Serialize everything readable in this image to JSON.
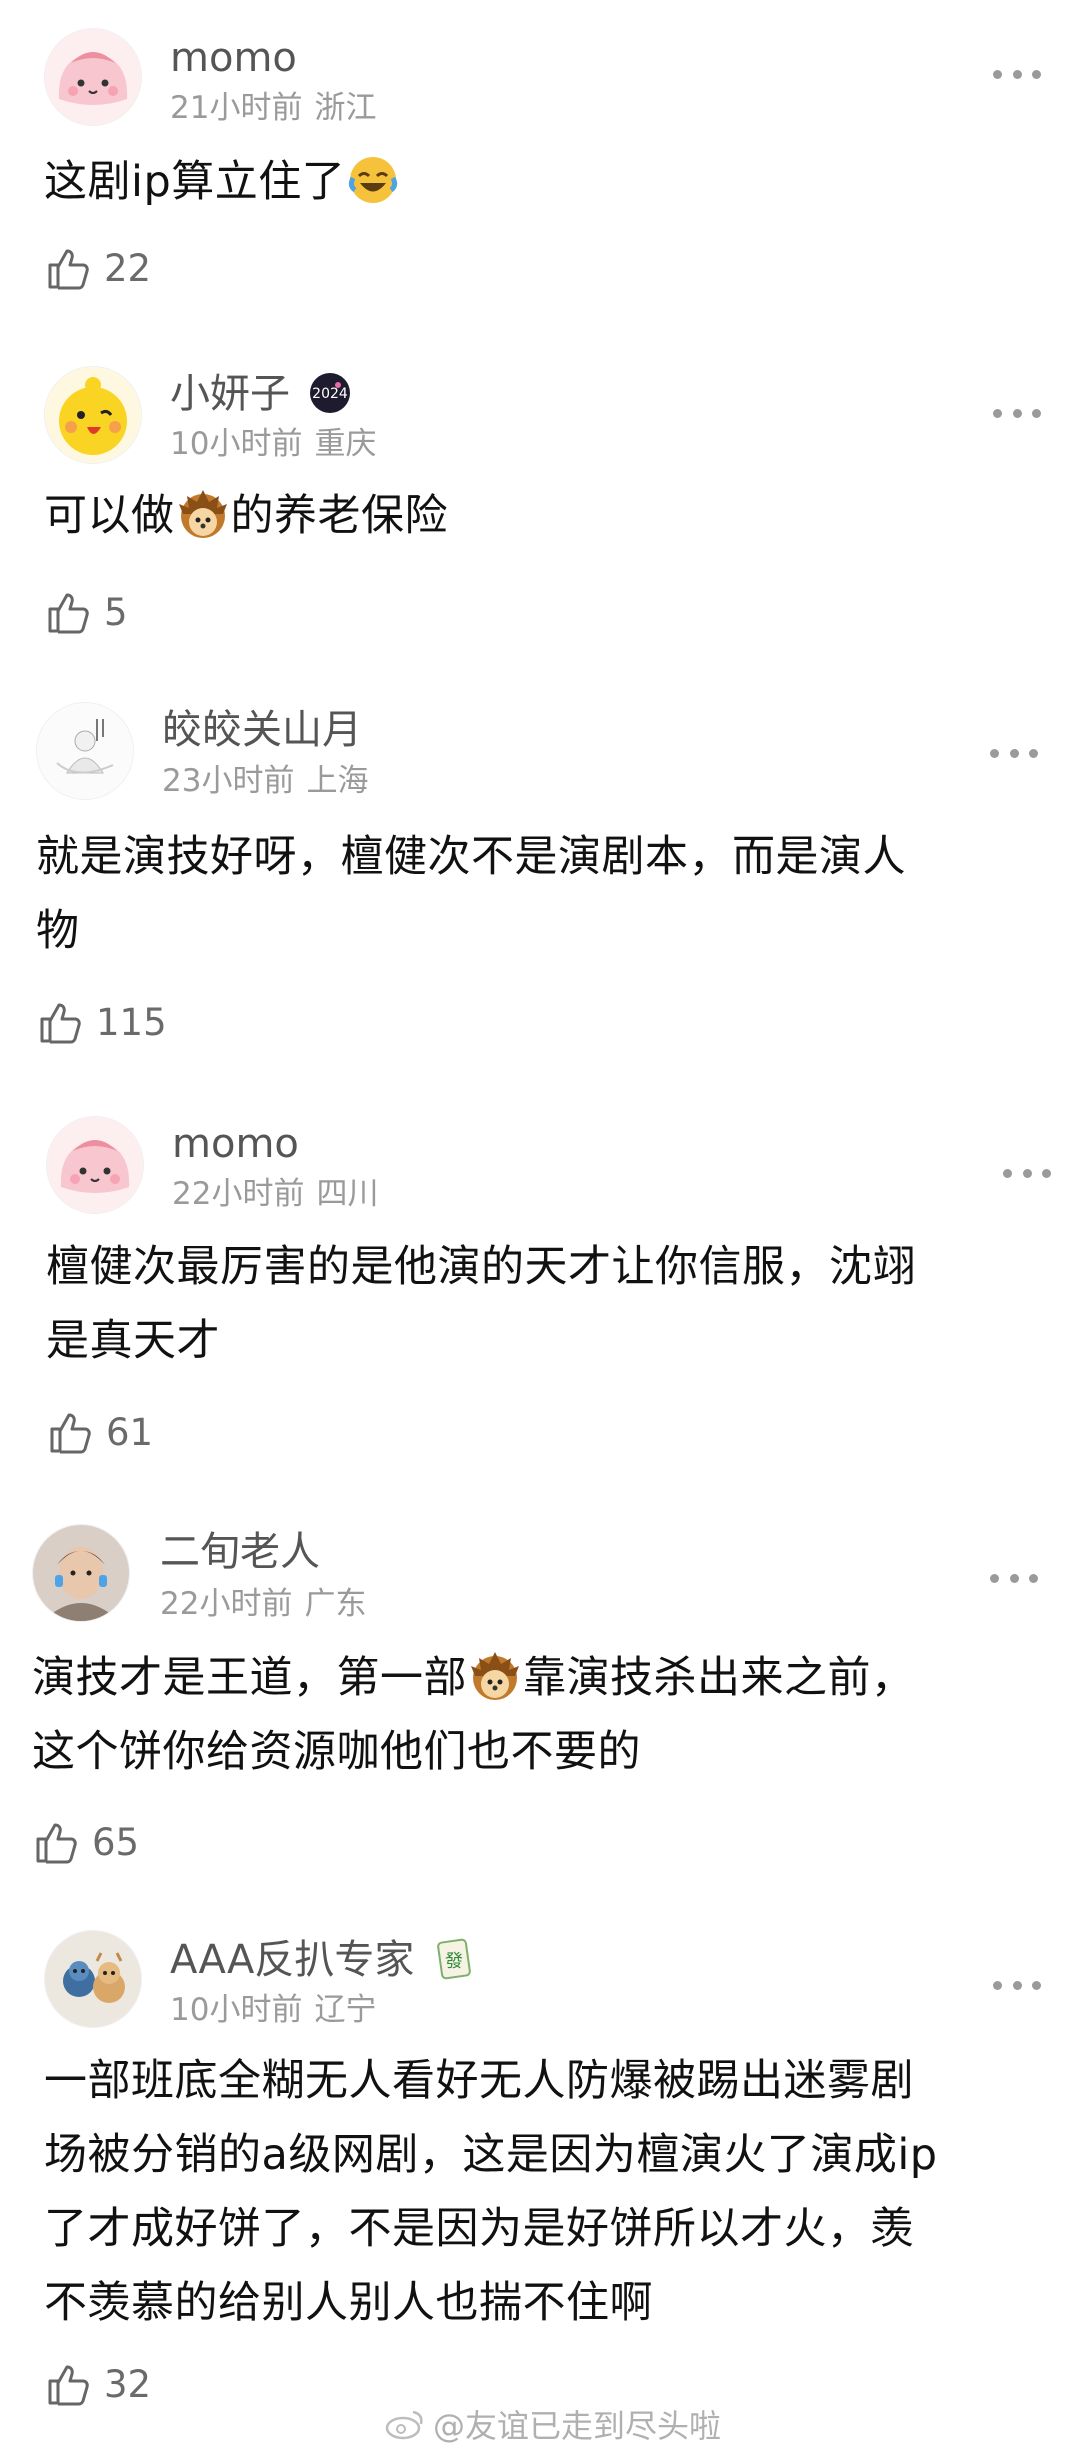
{
  "comments": [
    {
      "name": "momo",
      "time": "21小时前",
      "location": "浙江",
      "text_a": "这剧ip算立住了",
      "text_b": "",
      "text_c": "",
      "likes": "22",
      "avatar": "pink-blob-avatar",
      "emoji": "laugh-cry-emoji"
    },
    {
      "name": "小妍子",
      "time": "10小时前",
      "location": "重庆",
      "text_a": "可以做",
      "text_b": "的养老保险",
      "text_c": "",
      "likes": "5",
      "avatar": "yellow-chick-avatar",
      "emoji": "hedgehog-emoji"
    },
    {
      "name": "皎皎关山月",
      "time": "23小时前",
      "location": "上海",
      "text_a": "就是演技好呀，檀健次不是演剧本，而是演人",
      "text_b": "物",
      "text_c": "",
      "likes": "115",
      "avatar": "sketch-figure-avatar"
    },
    {
      "name": "momo",
      "time": "22小时前",
      "location": "四川",
      "text_a": "檀健次最厉害的是他演的天才让你信服，沈翊",
      "text_b": "是真天才",
      "text_c": "",
      "likes": "61",
      "avatar": "pink-blob-avatar"
    },
    {
      "name": "二旬老人",
      "time": "22小时前",
      "location": "广东",
      "text_a": "演技才是王道，第一部",
      "text_b": "靠演技杀出来之前，",
      "text_c": "这个饼你给资源咖他们也不要的",
      "likes": "65",
      "avatar": "photo-person-avatar",
      "emoji": "hedgehog-emoji"
    },
    {
      "name": "AAA反扒专家",
      "time": "10小时前",
      "location": "辽宁",
      "text_a": "一部班底全糊无人看好无人防爆被踢出迷雾剧",
      "text_b": "场被分销的a级网剧，这是因为檀演火了演成ip",
      "text_c": "了才成好饼了，不是因为是好饼所以才火，羡",
      "text_d": "不羡慕的给别人别人也揣不住啊",
      "likes": "32",
      "avatar": "plush-toys-avatar"
    }
  ],
  "watermark": "@友谊已走到尽头啦",
  "icons": {
    "like": "thumbs-up-icon",
    "more": "more-dots-icon",
    "weibo": "weibo-logo-icon"
  }
}
